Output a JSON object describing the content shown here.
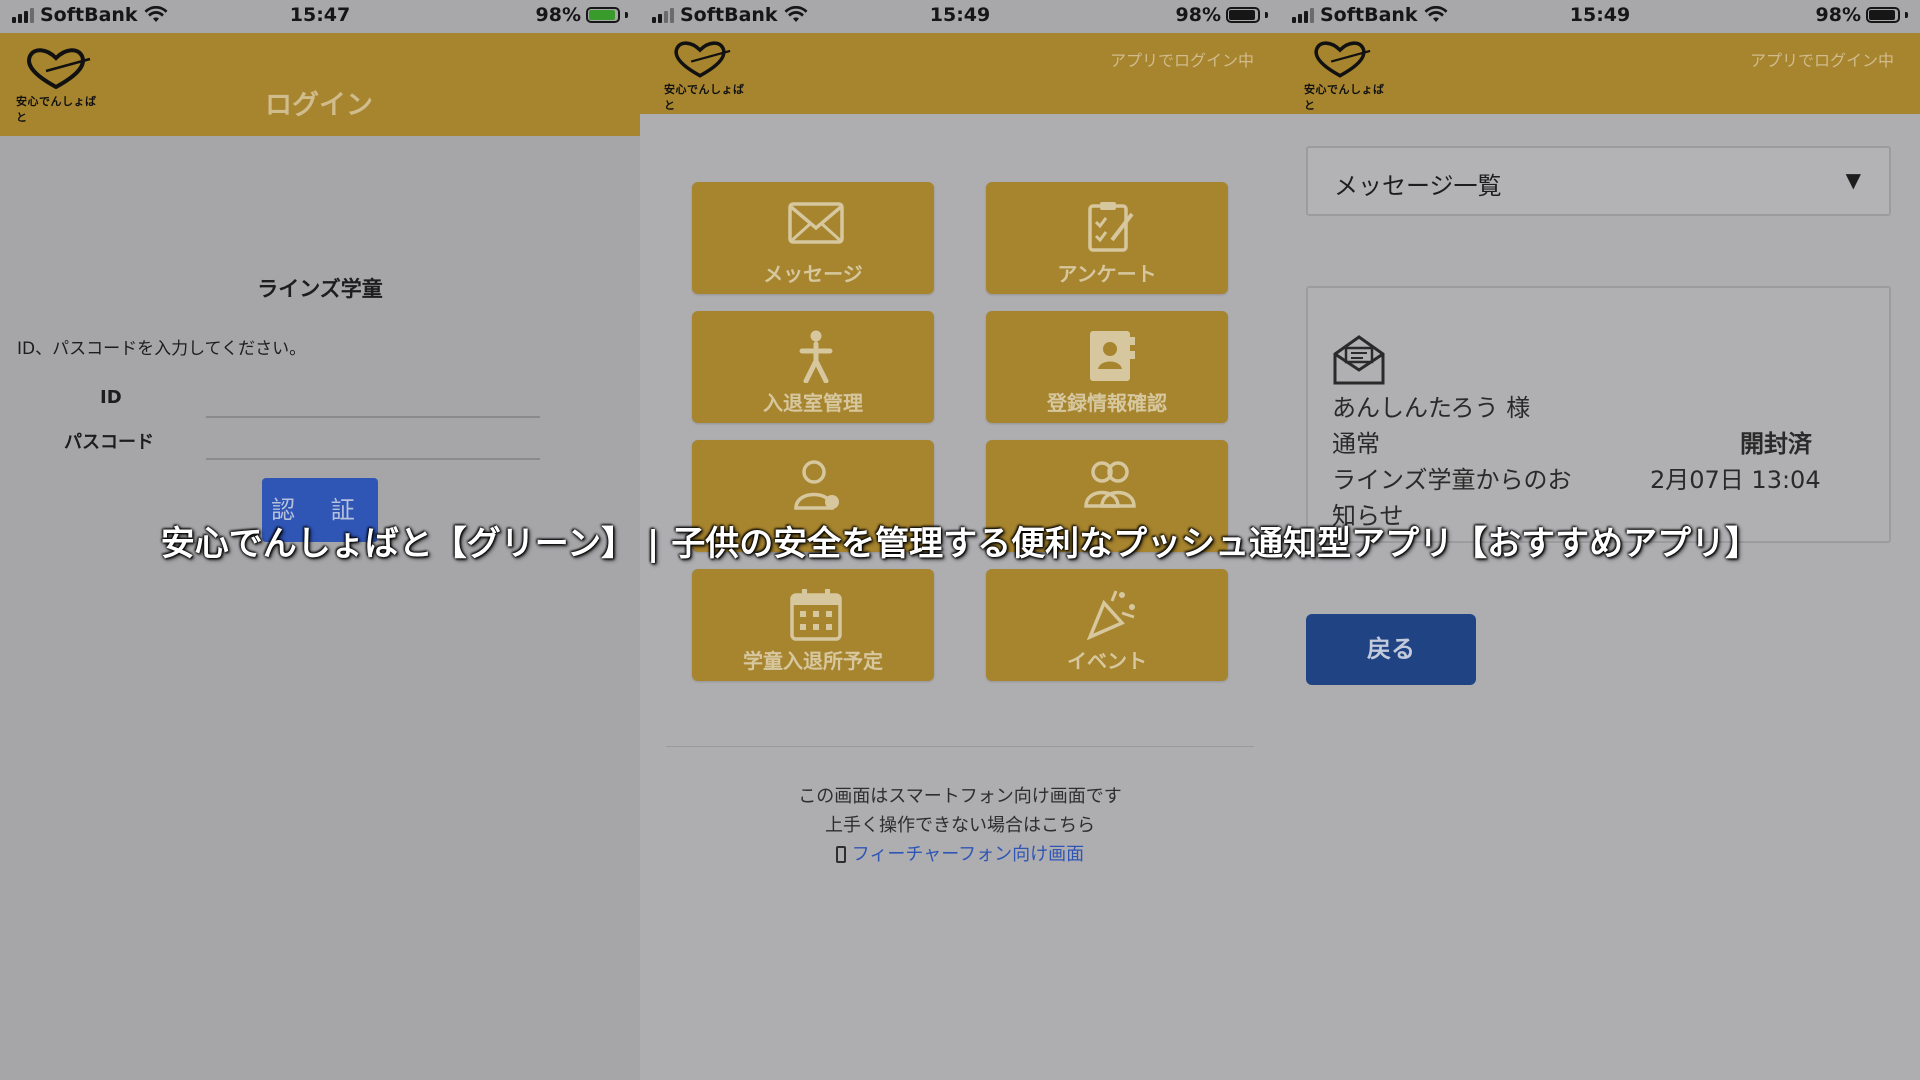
{
  "status_bars": [
    {
      "carrier": "SoftBank",
      "time": "15:47",
      "battery": "98%"
    },
    {
      "carrier": "SoftBank",
      "time": "15:49",
      "battery": "98%"
    },
    {
      "carrier": "SoftBank",
      "time": "15:49",
      "battery": "98%"
    }
  ],
  "app": {
    "logo_text": "安心でんしょばと",
    "login_status": "アプリでログイン中"
  },
  "login": {
    "title": "ログイン",
    "school": "ラインズ学童",
    "instruction": "ID、パスコードを入力してください。",
    "id_label": "ID",
    "passcode_label": "パスコード",
    "id_value": "",
    "passcode_value": "",
    "auth_button": "認 証"
  },
  "menu": {
    "tiles": [
      {
        "label": "メッセージ",
        "icon": "envelope-icon"
      },
      {
        "label": "アンケート",
        "icon": "clipboard-icon"
      },
      {
        "label": "入退室管理",
        "icon": "walking-person-icon"
      },
      {
        "label": "登録情報確認",
        "icon": "contact-card-icon"
      },
      {
        "label": "",
        "icon": "add-user-icon"
      },
      {
        "label": "",
        "icon": "users-icon"
      },
      {
        "label": "学童入退所予定",
        "icon": "calendar-icon"
      },
      {
        "label": "イベント",
        "icon": "party-popper-icon"
      }
    ],
    "footer_line1": "この画面はスマートフォン向け画面です",
    "footer_line2": "上手く操作できない場合はこちら",
    "footer_link": "フィーチャーフォン向け画面"
  },
  "messages": {
    "dropdown_value": "メッセージ一覧",
    "recipient": "あんしんたろう 様",
    "category": "通常",
    "read_status": "開封済",
    "subject_line1": "ラインズ学童からのお",
    "subject_line2": "知らせ",
    "date": "2月07日 13:04",
    "back_button": "戻る"
  },
  "caption": "安心でんしょばと【グリーン】 | 子供の安全を管理する便利なプッシュ通知型アプリ【おすすめアプリ】",
  "colors": {
    "header": "#a7842e",
    "tile": "#a7842e",
    "auth_button": "#2f55b5",
    "back_button": "#204483",
    "link": "#2f55b5"
  }
}
